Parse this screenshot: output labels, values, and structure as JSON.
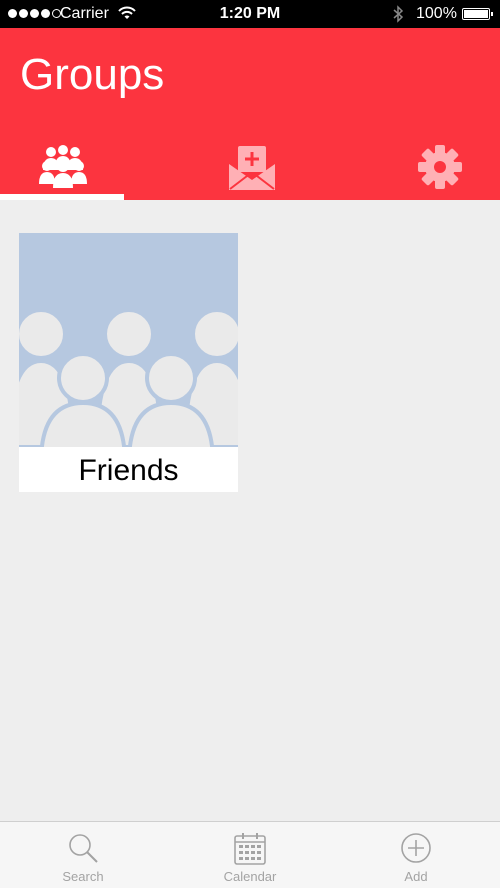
{
  "status_bar": {
    "carrier": "Carrier",
    "time": "1:20 PM",
    "battery": "100%"
  },
  "header": {
    "title": "Groups",
    "tabs": [
      {
        "icon": "people-icon",
        "active": true
      },
      {
        "icon": "mail-add-icon",
        "active": false
      },
      {
        "icon": "gear-icon",
        "active": false
      }
    ]
  },
  "groups": [
    {
      "name": "Friends"
    }
  ],
  "bottom_bar": {
    "items": [
      {
        "label": "Search",
        "icon": "search-icon"
      },
      {
        "label": "Calendar",
        "icon": "calendar-icon"
      },
      {
        "label": "Add",
        "icon": "add-icon"
      }
    ]
  },
  "colors": {
    "accent": "#fc343f",
    "background": "#eeeeee",
    "thumbnail": "#b6c8e0",
    "inactive_tab_icon": "#ffb0b5",
    "bottom_icon": "#a3a3a3"
  }
}
